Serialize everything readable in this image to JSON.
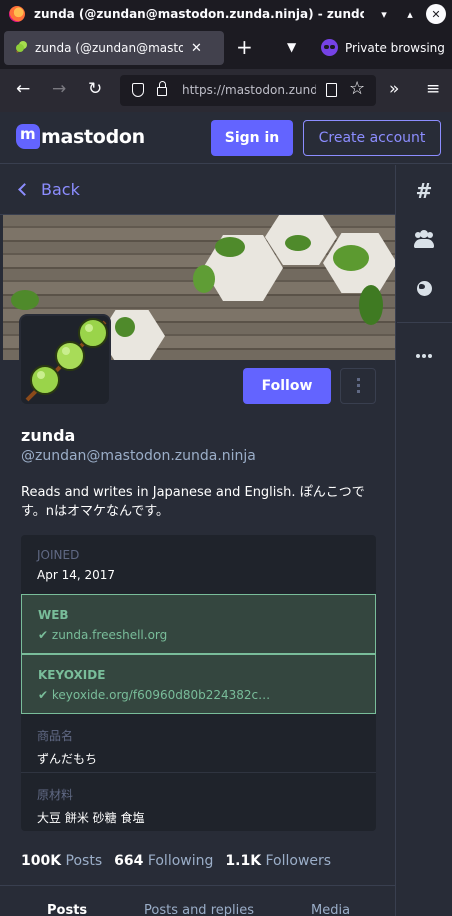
{
  "window": {
    "title": "zunda (@zundan@mastodon.zunda.ninja) - zundon — Mo",
    "buttons": [
      "minimize",
      "maximize",
      "close"
    ]
  },
  "tabs": {
    "active_label": "zunda (@zundan@mastodon.zunda.ninja) - zundon",
    "new_tab": "+",
    "private_label": "Private browsing"
  },
  "urlbar": {
    "url": "https://mastodon.zunda.ninja/@zundan"
  },
  "header": {
    "logo_text": "mastodon",
    "sign_in": "Sign in",
    "create_account": "Create account"
  },
  "nav": {
    "back": "Back"
  },
  "profile": {
    "display_name": "zunda",
    "account": "@zundan@mastodon.zunda.ninja",
    "bio": "Reads and writes in Japanese and English. ぽんこつです。nはオマケなんです。",
    "follow": "Follow"
  },
  "fields": [
    {
      "key": "JOINED",
      "value": "Apr 14, 2017",
      "verified": false
    },
    {
      "key": "WEB",
      "value": "zunda.freeshell.org",
      "verified": true
    },
    {
      "key": "KEYOXIDE",
      "value": "keyoxide.org/f60960d80b224382c…",
      "verified": true
    },
    {
      "key": "商品名",
      "value": "ずんだもち",
      "verified": false
    },
    {
      "key": "原材料",
      "value": "大豆 餅米 砂糖 食塩",
      "verified": false
    }
  ],
  "stats": {
    "posts_count": "100K",
    "posts_label": "Posts",
    "following_count": "664",
    "following_label": "Following",
    "followers_count": "1.1K",
    "followers_label": "Followers"
  },
  "profile_tabs": [
    "Posts",
    "Posts and replies",
    "Media"
  ],
  "icons": {
    "right_nav": [
      "hashtag-icon",
      "people-icon",
      "globe-icon",
      "more-icon"
    ]
  },
  "colors": {
    "brand": "#6364ff",
    "verified": "#79bd9a",
    "background": "#282c37"
  }
}
